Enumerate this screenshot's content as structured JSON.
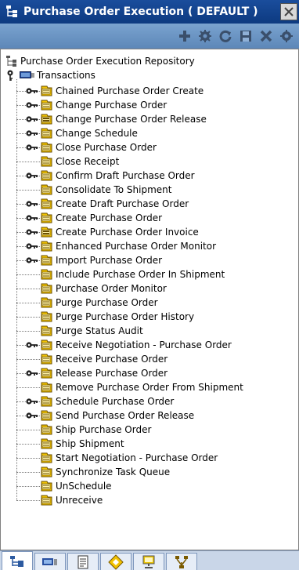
{
  "window": {
    "title": "Purchase Order Execution ( DEFAULT )",
    "title_icon": "tree-structure-icon",
    "close_icon": "close-icon"
  },
  "toolbar": {
    "buttons": [
      {
        "name": "add-button",
        "icon": "plus-icon"
      },
      {
        "name": "details-button",
        "icon": "gear-icon"
      },
      {
        "name": "refresh-button",
        "icon": "refresh-icon"
      },
      {
        "name": "save-button",
        "icon": "save-icon"
      },
      {
        "name": "delete-button",
        "icon": "delete-x-icon"
      },
      {
        "name": "extra-button",
        "icon": "gear-icon"
      }
    ]
  },
  "tree": {
    "root_label": "Purchase Order Execution Repository",
    "transactions_label": "Transactions",
    "items": [
      {
        "label": "Chained Purchase Order Create",
        "expandable": true,
        "icon": "doc"
      },
      {
        "label": "Change Purchase Order",
        "expandable": true,
        "icon": "doc"
      },
      {
        "label": "Change Purchase Order Release",
        "expandable": true,
        "icon": "doc-alt"
      },
      {
        "label": "Change Schedule",
        "expandable": true,
        "icon": "doc"
      },
      {
        "label": "Close Purchase Order",
        "expandable": true,
        "icon": "doc"
      },
      {
        "label": "Close Receipt",
        "expandable": false,
        "icon": "doc"
      },
      {
        "label": "Confirm Draft Purchase Order",
        "expandable": true,
        "icon": "doc"
      },
      {
        "label": "Consolidate To Shipment",
        "expandable": false,
        "icon": "doc"
      },
      {
        "label": "Create Draft Purchase Order",
        "expandable": true,
        "icon": "doc"
      },
      {
        "label": "Create Purchase Order",
        "expandable": true,
        "icon": "doc"
      },
      {
        "label": "Create Purchase Order Invoice",
        "expandable": true,
        "icon": "doc-alt"
      },
      {
        "label": "Enhanced Purchase Order Monitor",
        "expandable": true,
        "icon": "doc"
      },
      {
        "label": "Import Purchase Order",
        "expandable": true,
        "icon": "doc"
      },
      {
        "label": "Include Purchase Order In Shipment",
        "expandable": false,
        "icon": "doc"
      },
      {
        "label": "Purchase Order Monitor",
        "expandable": false,
        "icon": "doc"
      },
      {
        "label": "Purge Purchase Order",
        "expandable": false,
        "icon": "doc"
      },
      {
        "label": "Purge Purchase Order History",
        "expandable": false,
        "icon": "doc"
      },
      {
        "label": "Purge Status Audit",
        "expandable": false,
        "icon": "doc"
      },
      {
        "label": "Receive Negotiation - Purchase Order",
        "expandable": true,
        "icon": "doc"
      },
      {
        "label": "Receive Purchase Order",
        "expandable": false,
        "icon": "doc"
      },
      {
        "label": "Release Purchase Order",
        "expandable": true,
        "icon": "doc"
      },
      {
        "label": "Remove Purchase Order From Shipment",
        "expandable": false,
        "icon": "doc"
      },
      {
        "label": "Schedule Purchase Order",
        "expandable": true,
        "icon": "doc"
      },
      {
        "label": "Send Purchase Order Release",
        "expandable": true,
        "icon": "doc"
      },
      {
        "label": "Ship Purchase Order",
        "expandable": false,
        "icon": "doc"
      },
      {
        "label": "Ship Shipment",
        "expandable": false,
        "icon": "doc"
      },
      {
        "label": "Start Negotiation - Purchase Order",
        "expandable": false,
        "icon": "doc"
      },
      {
        "label": "Synchronize Task Queue",
        "expandable": false,
        "icon": "doc"
      },
      {
        "label": "UnSchedule",
        "expandable": false,
        "icon": "doc"
      },
      {
        "label": "Unreceive",
        "expandable": false,
        "icon": "doc"
      }
    ]
  },
  "tabs": [
    {
      "name": "tab-tree",
      "icon": "tree-icon",
      "active": true
    },
    {
      "name": "tab-transactions",
      "icon": "transaction-icon",
      "active": false
    },
    {
      "name": "tab-documents",
      "icon": "document-icon",
      "active": false
    },
    {
      "name": "tab-status",
      "icon": "diamond-icon",
      "active": false
    },
    {
      "name": "tab-monitor",
      "icon": "monitor-icon",
      "active": false
    },
    {
      "name": "tab-network",
      "icon": "network-icon",
      "active": false
    }
  ],
  "colors": {
    "titlebar": "#1a4d9c",
    "toolbar": "#6b93c2",
    "doc_icon": "#e8b800",
    "key_icon": "#1f1f1f"
  }
}
